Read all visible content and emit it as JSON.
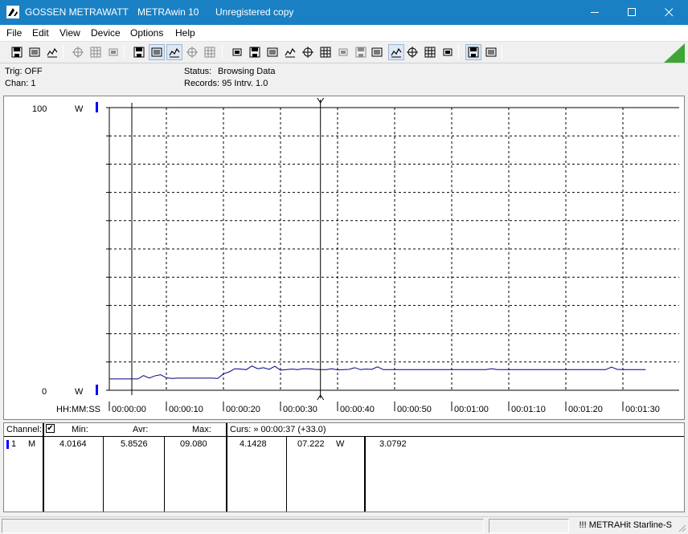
{
  "window": {
    "title_brand": "GOSSEN METRAWATT",
    "title_app": "METRAwin 10",
    "title_status": "Unregistered copy"
  },
  "menu": [
    "File",
    "Edit",
    "View",
    "Device",
    "Options",
    "Help"
  ],
  "toolbar_icons": [
    "save-icon",
    "save-as-icon",
    "open-folder-icon",
    "device-read-icon",
    "device-write-icon",
    "device-memory-icon",
    "table-view-icon",
    "graph-view-icon",
    "cursor-crosshair-icon",
    "grid-icon",
    "bar-view-icon",
    "export-icon",
    "import-icon",
    "list-icon",
    "computer-icon",
    "function-icon",
    "monitor-icon",
    "trigger-icon",
    "waveform-icon",
    "record-icon",
    "signal-icon",
    "print-icon",
    "print-setup-icon",
    "zoom-waveform-icon",
    "zoom-icon",
    "comment-icon"
  ],
  "info": {
    "trig": "Trig: OFF",
    "chan": "Chan:  1",
    "status_label": "Status:",
    "status_value": "Browsing Data",
    "records": "Records: 95   Intrv. 1.0"
  },
  "chart_data": {
    "type": "line",
    "y_top_label": "100",
    "y_bottom_label": "0",
    "y_unit": "W",
    "ylim": [
      0,
      100
    ],
    "x_axis_label": "HH:MM:SS",
    "x_tick_labels": [
      "00:00:00",
      "00:00:10",
      "00:00:20",
      "00:00:30",
      "00:00:40",
      "00:00:50",
      "00:01:00",
      "00:01:10",
      "00:01:20",
      "00:01:30"
    ],
    "xlim_seconds": [
      0,
      92
    ],
    "cursor_seconds": 37,
    "grid": true,
    "series": [
      {
        "color": "#000080",
        "x": [
          0,
          1,
          2,
          3,
          4,
          5,
          6,
          7,
          8,
          9,
          10,
          11,
          12,
          13,
          14,
          15,
          16,
          17,
          18,
          19,
          20,
          21,
          22,
          23,
          24,
          25,
          26,
          27,
          28,
          29,
          30,
          31,
          32,
          33,
          34,
          35,
          36,
          37,
          38,
          39,
          40,
          41,
          42,
          43,
          44,
          45,
          46,
          47,
          48,
          49,
          50,
          51,
          52,
          53,
          54,
          55,
          56,
          57,
          58,
          59,
          60,
          61,
          62,
          63,
          64,
          65,
          66,
          67,
          68,
          69,
          70,
          71,
          72,
          73,
          74,
          75,
          76,
          77,
          78,
          79,
          80,
          81,
          82,
          83,
          84,
          85,
          86,
          87,
          88,
          89,
          90,
          91,
          92,
          93,
          94
        ],
        "values": [
          4.0,
          4.0,
          4.0,
          4.0,
          4.0,
          4.0,
          5.2,
          4.3,
          5.1,
          5.5,
          4.4,
          4.2,
          4.3,
          4.3,
          4.3,
          4.3,
          4.3,
          4.3,
          4.3,
          4.2,
          5.8,
          6.5,
          7.6,
          7.5,
          7.3,
          8.6,
          7.6,
          8.0,
          7.4,
          8.5,
          7.1,
          7.3,
          7.5,
          7.3,
          7.6,
          7.6,
          7.4,
          7.3,
          7.3,
          7.6,
          7.2,
          7.3,
          7.4,
          8.0,
          7.3,
          7.5,
          7.4,
          8.3,
          7.3,
          7.3,
          7.3,
          7.3,
          7.3,
          7.3,
          7.3,
          7.3,
          7.3,
          7.3,
          7.3,
          7.3,
          7.3,
          7.3,
          7.3,
          7.3,
          7.3,
          7.3,
          7.3,
          7.6,
          7.3,
          7.3,
          7.3,
          7.3,
          7.3,
          7.3,
          7.3,
          7.3,
          7.3,
          7.3,
          7.3,
          7.3,
          7.3,
          7.3,
          7.3,
          7.3,
          7.3,
          7.3,
          7.3,
          7.3,
          8.2,
          7.4,
          7.3,
          7.3,
          7.3,
          7.3,
          7.3
        ]
      }
    ]
  },
  "table": {
    "headers": {
      "channel": "Channel:",
      "check": "✔",
      "min": "Min:",
      "avg": "Avr:",
      "max": "Max:",
      "cursor": "Curs: » 00:00:37 (+33.0)"
    },
    "row": {
      "channel_num": "1",
      "mode": "M",
      "min": "4.0164",
      "avg": "5.8526",
      "max": "09.080",
      "cursor_val": "4.1428",
      "value": "07.222",
      "unit": "W",
      "extra": "3.0792"
    }
  },
  "status": {
    "device": "!!! METRAHit Starline-S"
  },
  "colors": {
    "titlebar": "#1a80c4",
    "series": "#000080",
    "axis_marker": "#0000ff"
  }
}
